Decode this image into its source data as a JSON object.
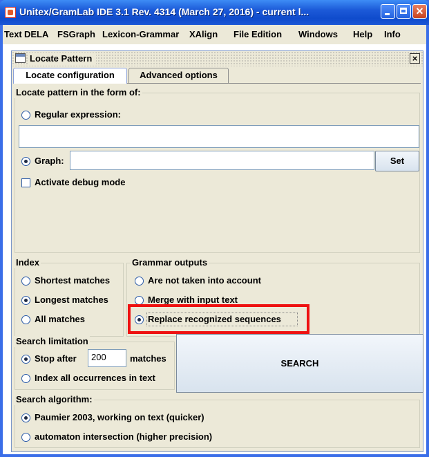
{
  "window": {
    "title": "Unitex/GramLab IDE 3.1  Rev. 4314 (March 27, 2016) - current l..."
  },
  "menu": [
    {
      "label": "Text"
    },
    {
      "label": "DELA"
    },
    {
      "label": "FSGraph"
    },
    {
      "label": "Lexicon-Grammar"
    },
    {
      "label": "XAlign"
    },
    {
      "label": "File Edition"
    },
    {
      "label": "Windows"
    },
    {
      "label": "Help"
    },
    {
      "label": "Info"
    }
  ],
  "dialog": {
    "title": "Locate Pattern",
    "close_glyph": "×"
  },
  "tabs": [
    {
      "label": "Locate configuration",
      "active": true
    },
    {
      "label": "Advanced options",
      "active": false
    }
  ],
  "locate_pattern": {
    "group_label": "Locate pattern in the form of:",
    "regex_label": "Regular expression:",
    "regex_selected": false,
    "regex_value": "",
    "graph_label": "Graph:",
    "graph_selected": true,
    "graph_value": "",
    "set_button": "Set",
    "debug_label": "Activate debug mode",
    "debug_checked": false
  },
  "index": {
    "group_label": "Index",
    "options": [
      {
        "label": "Shortest matches",
        "selected": false
      },
      {
        "label": "Longest matches",
        "selected": true
      },
      {
        "label": "All matches",
        "selected": false
      }
    ]
  },
  "grammar_outputs": {
    "group_label": "Grammar outputs",
    "options": [
      {
        "label": "Are not taken into account",
        "selected": false
      },
      {
        "label": "Merge with input text",
        "selected": false
      },
      {
        "label": "Replace recognized sequences",
        "selected": true
      }
    ]
  },
  "search_limitation": {
    "group_label": "Search limitation",
    "stop_after_label": "Stop after",
    "stop_after_selected": true,
    "stop_after_value": "200",
    "matches_label": "matches",
    "index_all_label": "Index all occurrences in text",
    "index_all_selected": false
  },
  "search_button": "SEARCH",
  "search_algorithm": {
    "group_label": "Search algorithm:",
    "options": [
      {
        "label": "Paumier 2003, working on text (quicker)",
        "selected": true
      },
      {
        "label": "automaton intersection (higher precision)",
        "selected": false
      }
    ]
  },
  "colors": {
    "titlebar": "#0f4bcc",
    "highlight": "#ee1111",
    "panel": "#ece9d8"
  }
}
